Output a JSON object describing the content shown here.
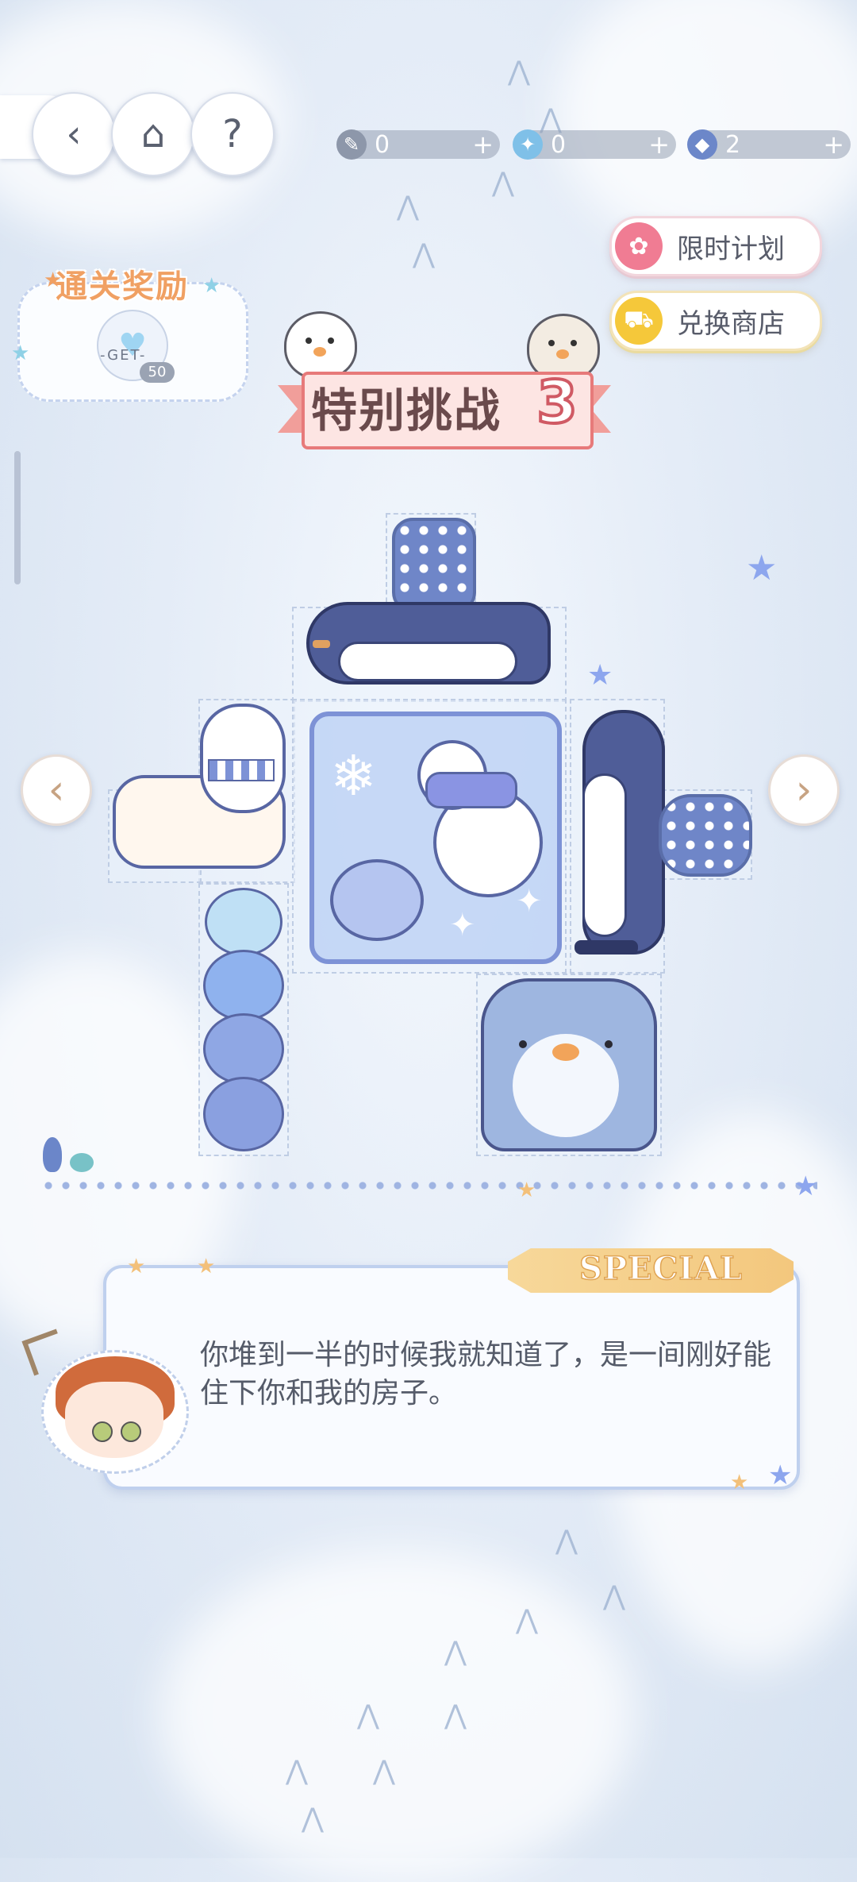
{
  "resources": [
    {
      "icon": "paint-brush-icon",
      "value": "0",
      "plus": "+"
    },
    {
      "icon": "wand-icon",
      "value": "0",
      "plus": "+"
    },
    {
      "icon": "gem-icon",
      "value": "2",
      "plus": "+"
    }
  ],
  "buttons": {
    "back": "‹",
    "home": "⌂",
    "help": "?",
    "limited_plan": "限时计划",
    "exchange_shop": "兑换商店",
    "prev": "‹",
    "next": "›"
  },
  "reward": {
    "title": "通关奖励",
    "get": "-GET-",
    "count": "50"
  },
  "banner": {
    "title": "特别挑战",
    "number": "3"
  },
  "dialog": {
    "tag": "SPECIAL",
    "text": "你堆到一半的时候我就知道了，是一间刚好能住下你和我的房子。"
  },
  "colors": {
    "accent_pink": "#f19e9a",
    "reward_orange": "#f0a063",
    "penguin_blue": "#4f5d98"
  }
}
